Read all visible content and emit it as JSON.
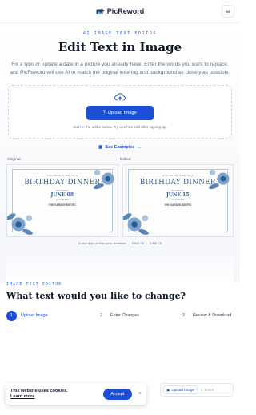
{
  "header": {
    "brand": "PicReword",
    "menu_icon": "hamburger-icon"
  },
  "hero": {
    "eyebrow": "AI IMAGE TEXT EDITOR",
    "title": "Edit Text in Image",
    "lead": "Fix a typo or update a date in a picture you already have. Enter the words you want to replace, and PicReword will use AI to match the original lettering and background as closely as possible.",
    "upload_button": "Upload Image",
    "upload_hint": "Start in the editor below. Try one free edit after signing up.",
    "see_examples": "See Examples"
  },
  "example": {
    "original_label": "Original",
    "edited_label": "Edited",
    "original": {
      "invited": "YOU'RE INVITED TO A",
      "title": "BIRTHDAY DINNER",
      "day": "SATURDAY",
      "date": "JUNE 08",
      "time": "AT 6:00 PM",
      "venue": "THE GARDEN BISTRO"
    },
    "edited": {
      "invited": "YOU'RE INVITED TO A",
      "title": "BIRTHDAY DINNER",
      "day": "SATURDAY",
      "date": "JUNE 15",
      "time": "AT 6:00 PM",
      "venue": "THE GARDEN BISTRO"
    },
    "caption_prefix": "A new date on the same invitation",
    "caption_from": "JUNE 08",
    "caption_to": "JUNE 15"
  },
  "editor": {
    "eyebrow": "IMAGE TEXT EDITOR",
    "title": "What text would you like to change?",
    "steps": [
      {
        "num": "1",
        "label": "Upload Image"
      },
      {
        "num": "2",
        "label": "Enter Changes"
      },
      {
        "num": "3",
        "label": "Review & Download"
      }
    ],
    "toolbar_upload": "Upload Image",
    "toolbar_zoom": "Zoom"
  },
  "cookie": {
    "title": "This website uses cookies.",
    "link": "Learn more",
    "accept": "Accept",
    "close": "×"
  },
  "colors": {
    "accent": "#1d4ed8",
    "eyebrow": "#2563eb",
    "text": "#0f172a"
  }
}
